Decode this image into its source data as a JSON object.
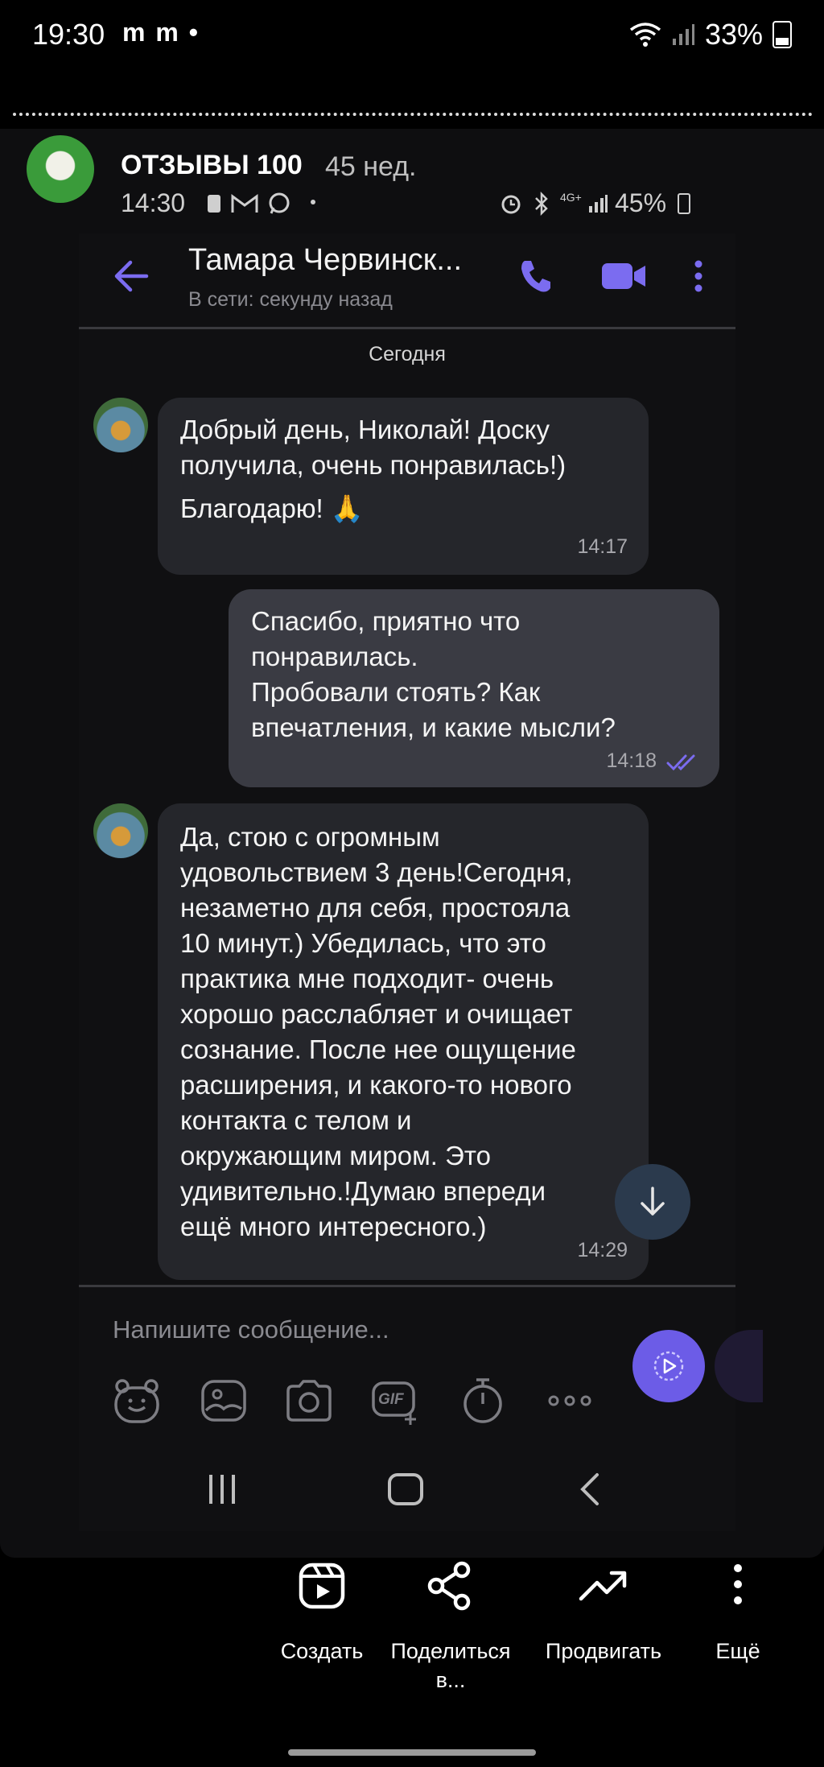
{
  "status_bar": {
    "time": "19:30",
    "notif_icons": "m m •",
    "battery": "33%"
  },
  "story": {
    "title": "ОТЗЫВЫ 100",
    "age": "45 нед.",
    "avatar_icon": "story-avatar"
  },
  "inner_status_bar": {
    "time": "14:30",
    "battery": "45%"
  },
  "chat": {
    "contact_name": "Тамара Червинск...",
    "contact_status": "В сети: секунду назад",
    "date_separator": "Сегодня",
    "messages": [
      {
        "direction": "incoming",
        "lines": [
          "Добрый день,  Николай! Доску",
          "получила, очень понравилась!)",
          "Благодарю! 🙏"
        ],
        "time": "14:17"
      },
      {
        "direction": "outgoing",
        "lines": [
          "Спасибо, приятно что",
          "понравилась.",
          "Пробовали стоять? Как",
          "впечатления, и какие мысли?"
        ],
        "time": "14:18",
        "read": true
      },
      {
        "direction": "incoming",
        "lines": [
          "Да, стою с огромным",
          "удовольствием 3 день!Сегодня,",
          "незаметно для себя, простояла",
          "10 минут.) Убедилась, что это",
          "практика мне подходит- очень",
          "хорошо расслабляет и очищает",
          "сознание. После нее ощущение",
          "расширения, и какого-то нового",
          "контакта с телом и",
          "окружающим миром. Это",
          "удивительно.!Думаю впереди",
          "ещё много интересного.)"
        ],
        "time": "14:29"
      }
    ],
    "composer_placeholder": "Напишите сообщение...",
    "gif_label": "GIF"
  },
  "actions": [
    {
      "label": "Создать",
      "icon": "reels-icon"
    },
    {
      "label": "Поделиться\nв...",
      "icon": "share-icon"
    },
    {
      "label": "Продвигать",
      "icon": "trending-icon"
    },
    {
      "label": "Ещё",
      "icon": "more-vertical-icon"
    }
  ],
  "colors": {
    "accent": "#6c5ce7",
    "incoming_bubble": "#25262b",
    "outgoing_bubble": "#3a3b43",
    "background": "#000000"
  }
}
